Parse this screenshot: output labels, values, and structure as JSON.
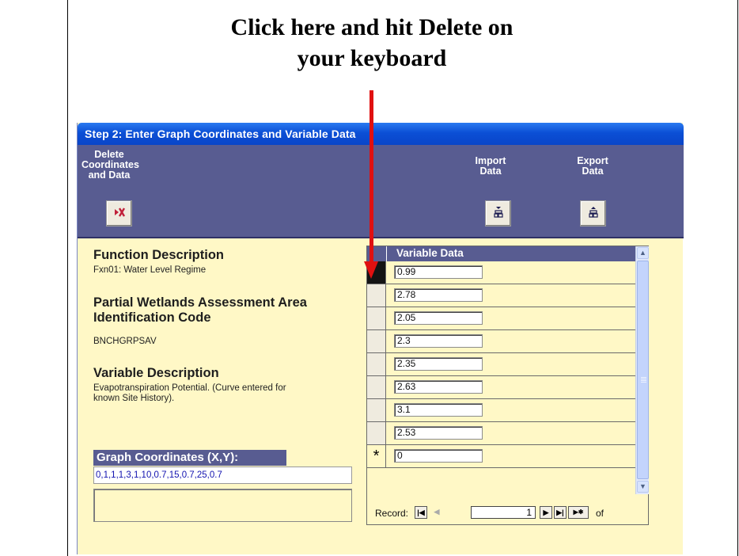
{
  "callout": {
    "line1": "Click here and hit Delete on",
    "line2": "your keyboard"
  },
  "window": {
    "title": "Step 2: Enter Graph Coordinates and Variable Data"
  },
  "toolbar": {
    "delete_label_1": "Delete",
    "delete_label_2": "Coordinates",
    "delete_label_3": "and Data",
    "delete_icon": "delete-record-icon",
    "import_label_1": "Import",
    "import_label_2": "Data",
    "import_icon": "import-icon",
    "export_label_1": "Export",
    "export_label_2": "Data",
    "export_icon": "export-icon"
  },
  "form": {
    "function_heading": "Function Description",
    "function_value": "Fxn01: Water Level Regime",
    "pwaa_heading_1": "Partial Wetlands Assessment Area",
    "pwaa_heading_2": "Identification Code",
    "pwaa_value": "BNCHGRPSAV",
    "variable_heading": "Variable Description",
    "variable_value_1": "Evapotranspiration Potential.  (Curve entered for",
    "variable_value_2": "known Site History).",
    "graph_label": "Graph Coordinates (X,Y):",
    "graph_value": "0,1,1,1,3,1,10,0.7,15,0.7,25,0.7"
  },
  "subform": {
    "column_header": "Variable Data",
    "rows": [
      "0.99",
      "2.78",
      "2.05",
      "2.3",
      "2.35",
      "2.63",
      "3.1",
      "2.53"
    ],
    "new_row_value": "0",
    "new_row_marker": "*",
    "record_label": "Record:",
    "record_number": "1",
    "of_label": "of"
  },
  "colors": {
    "form_background": "#FFF8C6",
    "header_band": "#585C91",
    "title_bar": "#0b4fd6",
    "arrow": "#e01010"
  }
}
